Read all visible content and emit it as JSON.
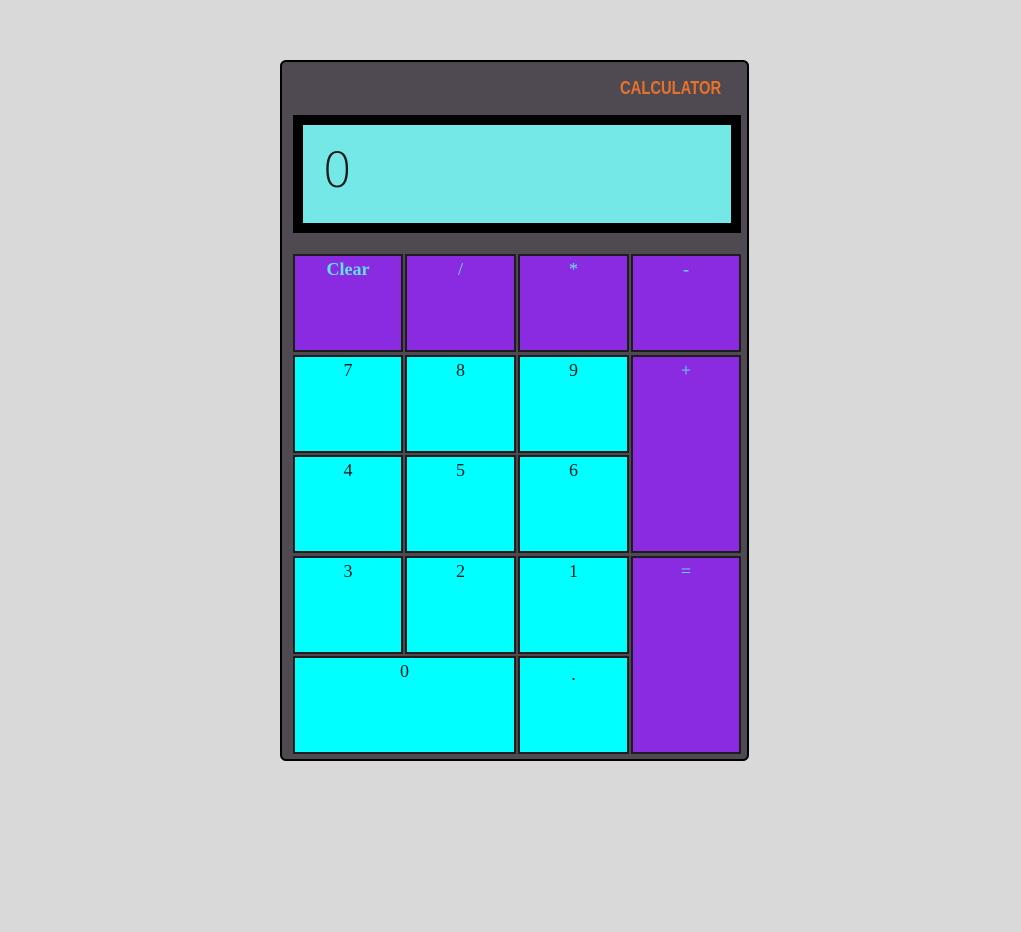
{
  "brand": {
    "title": "CALCULATOR",
    "color": "#e8722a"
  },
  "display": {
    "value": "0"
  },
  "colors": {
    "page_background": "#d9d9d9",
    "body": "#4f4a52",
    "screen": "#74e8e6",
    "operator_key": "#8a2be2",
    "operator_text": "#5de4f0",
    "number_key": "#00ffff"
  },
  "keys": {
    "clear": "Clear",
    "divide": "/",
    "multiply": "*",
    "subtract": "-",
    "add": "+",
    "equals": "=",
    "seven": "7",
    "eight": "8",
    "nine": "9",
    "four": "4",
    "five": "5",
    "six": "6",
    "three": "3",
    "two": "2",
    "one": "1",
    "zero": "0",
    "decimal": "."
  }
}
